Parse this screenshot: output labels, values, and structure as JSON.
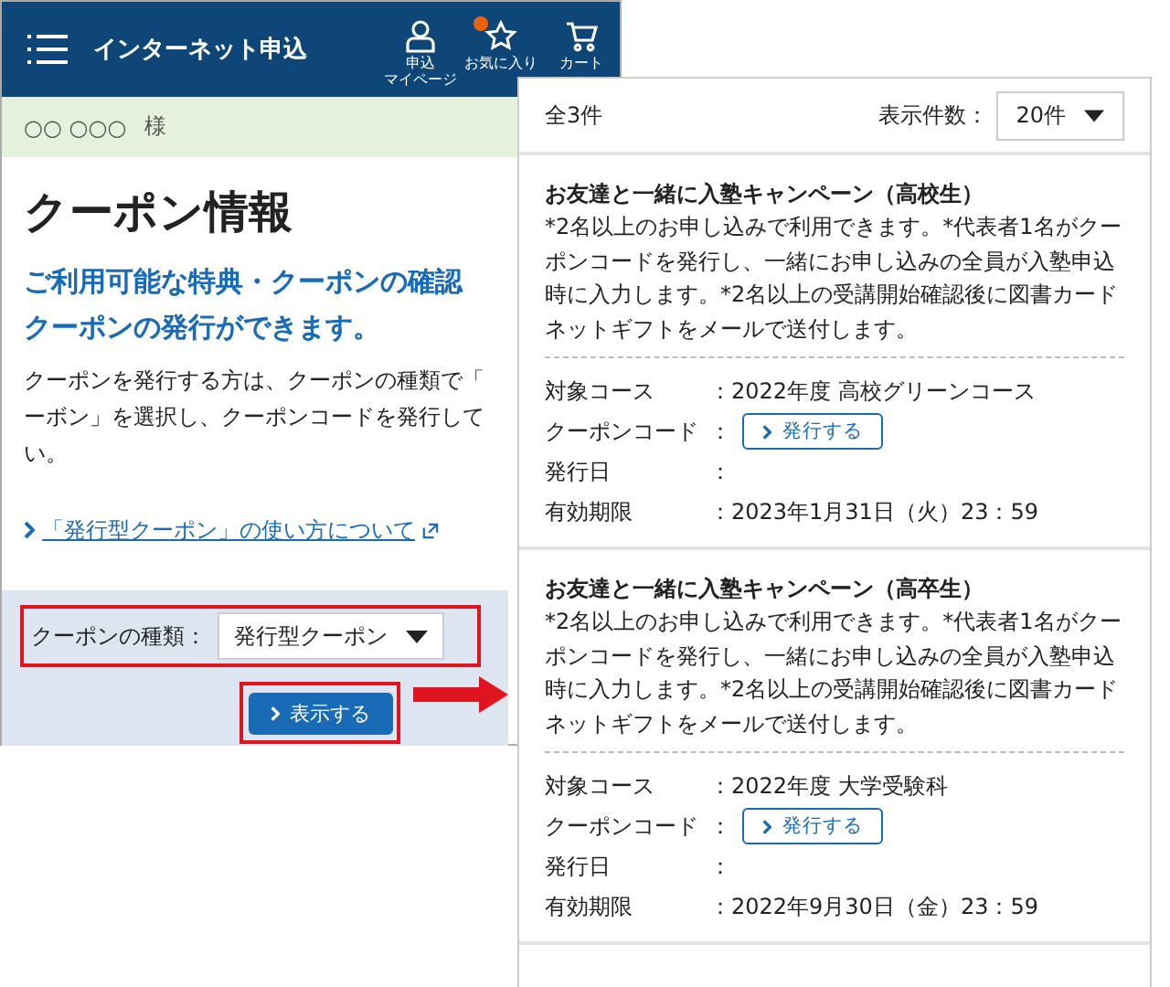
{
  "header": {
    "title": "インターネット申込",
    "actions": [
      {
        "kind": "person",
        "lines": [
          "申込",
          "マイページ"
        ],
        "badge": false
      },
      {
        "kind": "star",
        "lines": [
          "お気に入り"
        ],
        "badge": true
      },
      {
        "kind": "cart",
        "lines": [
          "カート"
        ],
        "badge": false
      }
    ]
  },
  "user_bar": {
    "name": "○○ ○○○",
    "suffix": "様"
  },
  "page_title": "クーポン情報",
  "lead": "ご利用可能な特典・クーポンの確認クーポンの発行ができます。",
  "description": "クーポンを発行する方は、クーポンの種類で「ーボン」を選択し、クーポンコードを発行してい。",
  "guide_link": "「発行型クーポン」の使い方について",
  "filter": {
    "label": "クーポンの種類：",
    "value": "発行型クーポン"
  },
  "show_button": "表示する",
  "results": {
    "count": "全3件",
    "per_page_label": "表示件数：",
    "per_page_value": "20件",
    "coupons": [
      {
        "title": "お友達と一緒に入塾キャンペーン（高校生）",
        "note": "*2名以上のお申し込みで利用できます。*代表者1名がクーポンコードを発行し、一緒にお申し込みの全員が入塾申込時に入力します。*2名以上の受講開始確認後に図書カードネットギフトをメールで送付します。",
        "fields": [
          {
            "kind": "text",
            "label": "対象コース",
            "value": "：2022年度 高校グリーンコース"
          },
          {
            "kind": "button",
            "label": "クーポンコード",
            "sep": "：",
            "button": "発行する"
          },
          {
            "kind": "text",
            "label": "発行日",
            "value": "："
          },
          {
            "kind": "text",
            "label": "有効期限",
            "value": "：2023年1月31日（火）23：59"
          }
        ]
      },
      {
        "title": "お友達と一緒に入塾キャンペーン（高卒生）",
        "note": "*2名以上のお申し込みで利用できます。*代表者1名がクーポンコードを発行し、一緒にお申し込みの全員が入塾申込時に入力します。*2名以上の受講開始確認後に図書カードネットギフトをメールで送付します。",
        "fields": [
          {
            "kind": "text",
            "label": "対象コース",
            "value": "：2022年度 大学受験科"
          },
          {
            "kind": "button",
            "label": "クーポンコード",
            "sep": "：",
            "button": "発行する"
          },
          {
            "kind": "text",
            "label": "発行日",
            "value": "："
          },
          {
            "kind": "text",
            "label": "有効期限",
            "value": "：2022年9月30日（金）23：59"
          }
        ]
      }
    ]
  }
}
